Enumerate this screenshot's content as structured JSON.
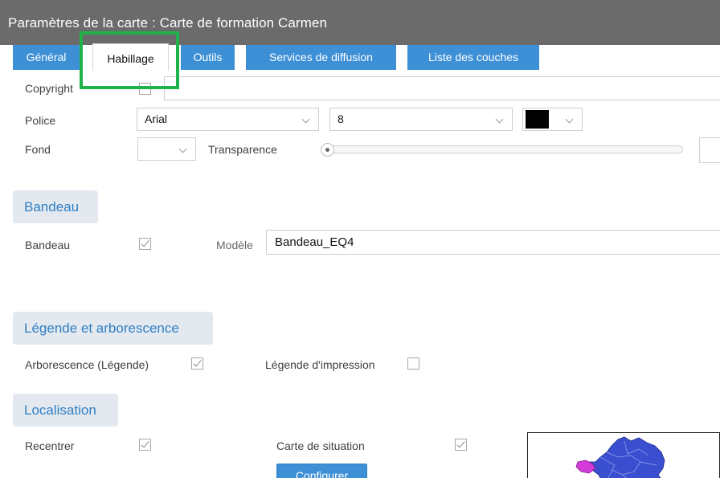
{
  "window": {
    "title": "Paramètres de la carte : Carte de formation Carmen"
  },
  "tabs": [
    {
      "label": "Général"
    },
    {
      "label": "Habillage"
    },
    {
      "label": "Outils"
    },
    {
      "label": "Services de diffusion"
    },
    {
      "label": "Liste des couches"
    }
  ],
  "habillage": {
    "copyright_label": "Copyright",
    "police_label": "Police",
    "police_value": "Arial",
    "size_value": "8",
    "font_color": "#000000",
    "fond_label": "Fond",
    "transparence_label": "Transparence",
    "transparence_value": 0
  },
  "bandeau_section": {
    "title": "Bandeau",
    "bandeau_label": "Bandeau",
    "modele_label": "Modèle",
    "modele_value": "Bandeau_EQ4"
  },
  "legende_section": {
    "title": "Légende et arborescence",
    "arborescence_label": "Arborescence (Légende)",
    "impression_label": "Légende d'impression"
  },
  "localisation_section": {
    "title": "Localisation",
    "recentrer_label": "Recentrer",
    "situation_label": "Carte de situation",
    "configurer_label": "Configurer"
  },
  "colors": {
    "tab_blue": "#3d8fd6",
    "section_text": "#2f7fc4",
    "highlight_green": "#20b24a",
    "map_fill": "#3a4fd0",
    "map_highlight": "#d23bd8"
  }
}
